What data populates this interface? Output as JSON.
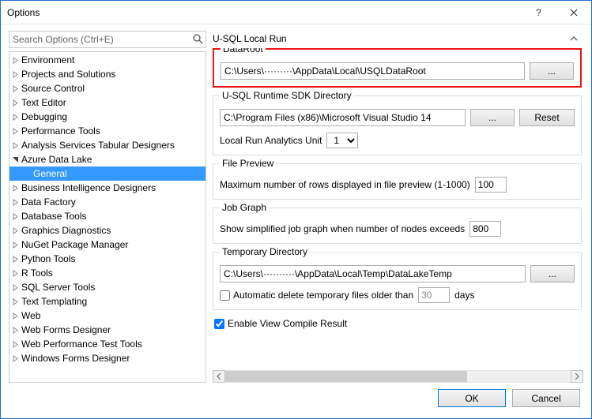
{
  "window": {
    "title": "Options"
  },
  "search": {
    "placeholder": "Search Options (Ctrl+E)"
  },
  "tree": {
    "items": [
      {
        "label": "Environment",
        "expandable": true,
        "expanded": false,
        "indent": 0
      },
      {
        "label": "Projects and Solutions",
        "expandable": true,
        "expanded": false,
        "indent": 0
      },
      {
        "label": "Source Control",
        "expandable": true,
        "expanded": false,
        "indent": 0
      },
      {
        "label": "Text Editor",
        "expandable": true,
        "expanded": false,
        "indent": 0
      },
      {
        "label": "Debugging",
        "expandable": true,
        "expanded": false,
        "indent": 0
      },
      {
        "label": "Performance Tools",
        "expandable": true,
        "expanded": false,
        "indent": 0
      },
      {
        "label": "Analysis Services Tabular Designers",
        "expandable": true,
        "expanded": false,
        "indent": 0
      },
      {
        "label": "Azure Data Lake",
        "expandable": true,
        "expanded": true,
        "indent": 0
      },
      {
        "label": "General",
        "expandable": false,
        "expanded": false,
        "indent": 1,
        "selected": true
      },
      {
        "label": "Business Intelligence Designers",
        "expandable": true,
        "expanded": false,
        "indent": 0
      },
      {
        "label": "Data Factory",
        "expandable": true,
        "expanded": false,
        "indent": 0
      },
      {
        "label": "Database Tools",
        "expandable": true,
        "expanded": false,
        "indent": 0
      },
      {
        "label": "Graphics Diagnostics",
        "expandable": true,
        "expanded": false,
        "indent": 0
      },
      {
        "label": "NuGet Package Manager",
        "expandable": true,
        "expanded": false,
        "indent": 0
      },
      {
        "label": "Python Tools",
        "expandable": true,
        "expanded": false,
        "indent": 0
      },
      {
        "label": "R Tools",
        "expandable": true,
        "expanded": false,
        "indent": 0
      },
      {
        "label": "SQL Server Tools",
        "expandable": true,
        "expanded": false,
        "indent": 0
      },
      {
        "label": "Text Templating",
        "expandable": true,
        "expanded": false,
        "indent": 0
      },
      {
        "label": "Web",
        "expandable": true,
        "expanded": false,
        "indent": 0
      },
      {
        "label": "Web Forms Designer",
        "expandable": true,
        "expanded": false,
        "indent": 0
      },
      {
        "label": "Web Performance Test Tools",
        "expandable": true,
        "expanded": false,
        "indent": 0
      },
      {
        "label": "Windows Forms Designer",
        "expandable": true,
        "expanded": false,
        "indent": 0
      }
    ]
  },
  "panel": {
    "heading": "U-SQL Local Run",
    "dataroot": {
      "legend": "DataRoot",
      "path": "C:\\Users\\·········\\AppData\\Local\\USQLDataRoot",
      "browse": "..."
    },
    "sdk": {
      "legend": "U-SQL Runtime SDK Directory",
      "path": "C:\\Program Files (x86)\\Microsoft Visual Studio 14",
      "browse": "...",
      "reset": "Reset",
      "analytics_label": "Local Run Analytics Unit",
      "analytics_value": "1"
    },
    "filepreview": {
      "legend": "File Preview",
      "label": "Maximum number of rows displayed in file preview (1-1000)",
      "value": "100"
    },
    "jobgraph": {
      "legend": "Job Graph",
      "label": "Show simplified job graph when number of nodes exceeds",
      "value": "800"
    },
    "tempdir": {
      "legend": "Temporary Directory",
      "path": "C:\\Users\\··········\\AppData\\Local\\Temp\\DataLakeTemp",
      "browse": "...",
      "auto_label_pre": "Automatic delete temporary files older than",
      "auto_value": "30",
      "auto_label_post": "days"
    },
    "enable_compile": "Enable View Compile Result"
  },
  "buttons": {
    "ok": "OK",
    "cancel": "Cancel"
  }
}
